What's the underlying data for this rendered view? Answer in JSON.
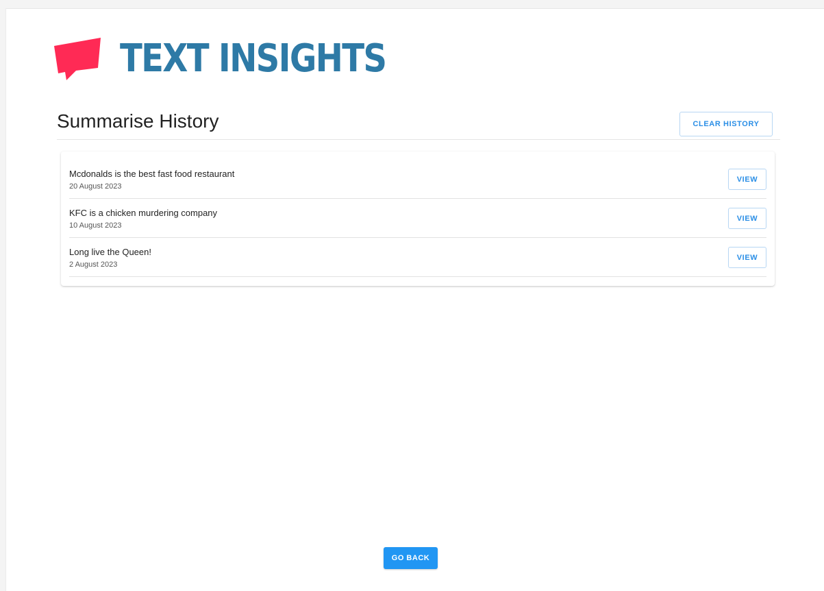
{
  "header": {
    "logo_icon": "speech-bubble-icon",
    "logo_text": "TEXT INSIGHTS",
    "logo_color": "#ff2a55",
    "brand_color": "#2e7aa6"
  },
  "history": {
    "title": "Summarise History",
    "clear_label": "CLEAR HISTORY",
    "items": [
      {
        "title": "Mcdonalds is the best fast food restaurant",
        "date": "20 August 2023",
        "view_label": "VIEW"
      },
      {
        "title": "KFC is a chicken murdering company",
        "date": "10 August 2023",
        "view_label": "VIEW"
      },
      {
        "title": "Long live the Queen!",
        "date": "2 August 2023",
        "view_label": "VIEW"
      }
    ]
  },
  "footer": {
    "go_back_label": "GO BACK"
  },
  "colors": {
    "accent": "#2196f3",
    "outline_text": "#2a8ee6"
  }
}
